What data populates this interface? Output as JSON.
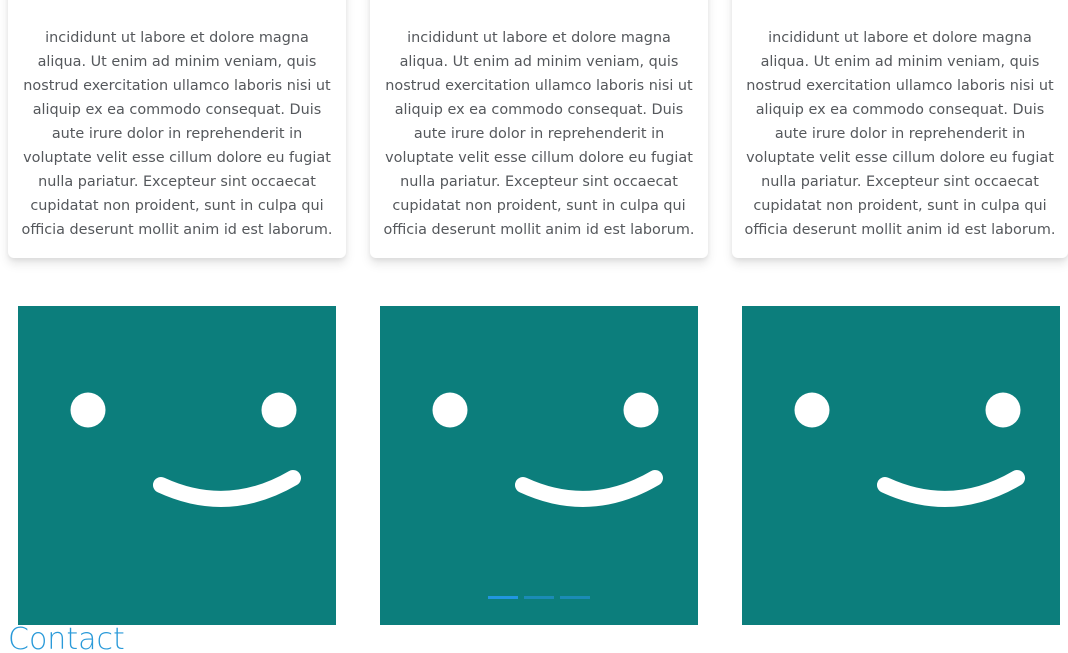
{
  "cards": [
    {
      "text": "incididunt ut labore et dolore magna aliqua. Ut enim ad minim veniam, quis nostrud exercitation ullamco laboris nisi ut aliquip ex ea commodo consequat. Duis aute irure dolor in reprehenderit in voluptate velit esse cillum dolore eu fugiat nulla pariatur. Excepteur sint occaecat cupidatat non proident, sunt in culpa qui officia deserunt mollit anim id est laborum."
    },
    {
      "text": "incididunt ut labore et dolore magna aliqua. Ut enim ad minim veniam, quis nostrud exercitation ullamco laboris nisi ut aliquip ex ea commodo consequat. Duis aute irure dolor in reprehenderit in voluptate velit esse cillum dolore eu fugiat nulla pariatur. Excepteur sint occaecat cupidatat non proident, sunt in culpa qui officia deserunt mollit anim id est laborum."
    },
    {
      "text": "incididunt ut labore et dolore magna aliqua. Ut enim ad minim veniam, quis nostrud exercitation ullamco laboris nisi ut aliquip ex ea commodo consequat. Duis aute irure dolor in reprehenderit in voluptate velit esse cillum dolore eu fugiat nulla pariatur. Excepteur sint occaecat cupidatat non proident, sunt in culpa qui officia deserunt mollit anim id est laborum."
    }
  ],
  "tiles": [
    {
      "icon": "smiley-face-icon"
    },
    {
      "icon": "smiley-face-icon"
    },
    {
      "icon": "smiley-face-icon"
    }
  ],
  "carousel": {
    "slide_count": 3,
    "active_index": 0
  },
  "colors": {
    "tile_background": "#0c7e7c",
    "face": "#ffffff",
    "accent": "#2a9ad9",
    "indicator_active": "#2196e0",
    "body_text": "#55585c"
  },
  "contact": {
    "title": "Contact"
  }
}
